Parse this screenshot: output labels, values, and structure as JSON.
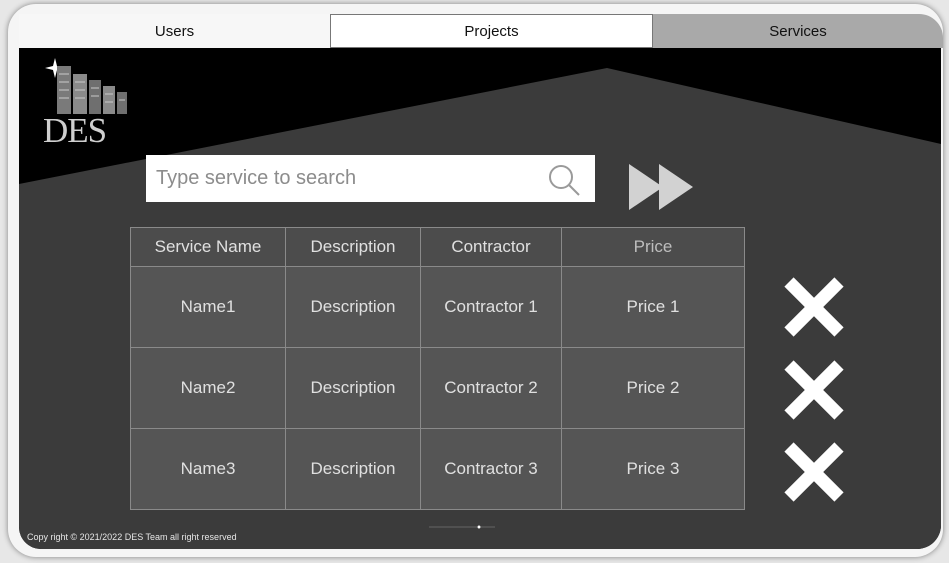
{
  "tabs": [
    {
      "label": "Users",
      "active": false
    },
    {
      "label": "Projects",
      "active": false
    },
    {
      "label": "Services",
      "active": true
    }
  ],
  "logo": {
    "text": "DES"
  },
  "search": {
    "placeholder": "Type service to search",
    "value": ""
  },
  "table": {
    "headers": [
      "Service Name",
      "Description",
      "Contractor",
      "Price"
    ],
    "rows": [
      [
        "Name1",
        "Description",
        "Contractor 1",
        "Price 1"
      ],
      [
        "Name2",
        "Description",
        "Contractor 2",
        "Price 2"
      ],
      [
        "Name3",
        "Description",
        "Contractor 3",
        "Price 3"
      ]
    ]
  },
  "footer": {
    "copyright": "Copy right © 2021/2022  DES Team all right reserved"
  },
  "colors": {
    "background": "#000000",
    "panel": "#3b3b3b",
    "cell": "#555555",
    "active_tab": "#a9a9a9"
  }
}
